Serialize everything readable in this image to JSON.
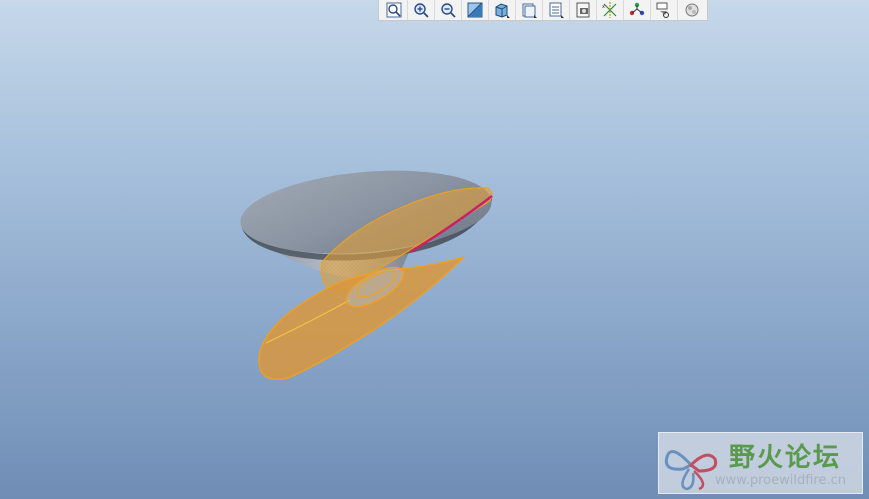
{
  "toolbar": {
    "buttons": [
      {
        "icon": "refit-icon",
        "tooltip": ""
      },
      {
        "icon": "zoom-in-icon",
        "tooltip": ""
      },
      {
        "icon": "zoom-out-icon",
        "tooltip": ""
      },
      {
        "icon": "repaint-icon",
        "tooltip": ""
      },
      {
        "icon": "display-style-icon",
        "tooltip": ""
      },
      {
        "icon": "saved-orientations-icon",
        "tooltip": ""
      },
      {
        "icon": "view-manager-icon",
        "tooltip": ""
      },
      {
        "icon": "datum-display-icon",
        "tooltip": ""
      },
      {
        "icon": "annotation-display-icon",
        "tooltip": ""
      },
      {
        "icon": "spin-center-icon",
        "tooltip": ""
      },
      {
        "icon": "appearance-gallery-icon",
        "tooltip": ""
      }
    ]
  },
  "colors": {
    "background_top": "#c6d8ea",
    "background_bottom": "#6f8db5",
    "surface_orange": "#e8a030",
    "edge_orange": "#f0a020",
    "disk_gray": "#8e98a6",
    "edge_magenta": "#c8206a"
  },
  "watermark": {
    "title": "野火论坛",
    "url": "www.proewildfire.cn"
  }
}
